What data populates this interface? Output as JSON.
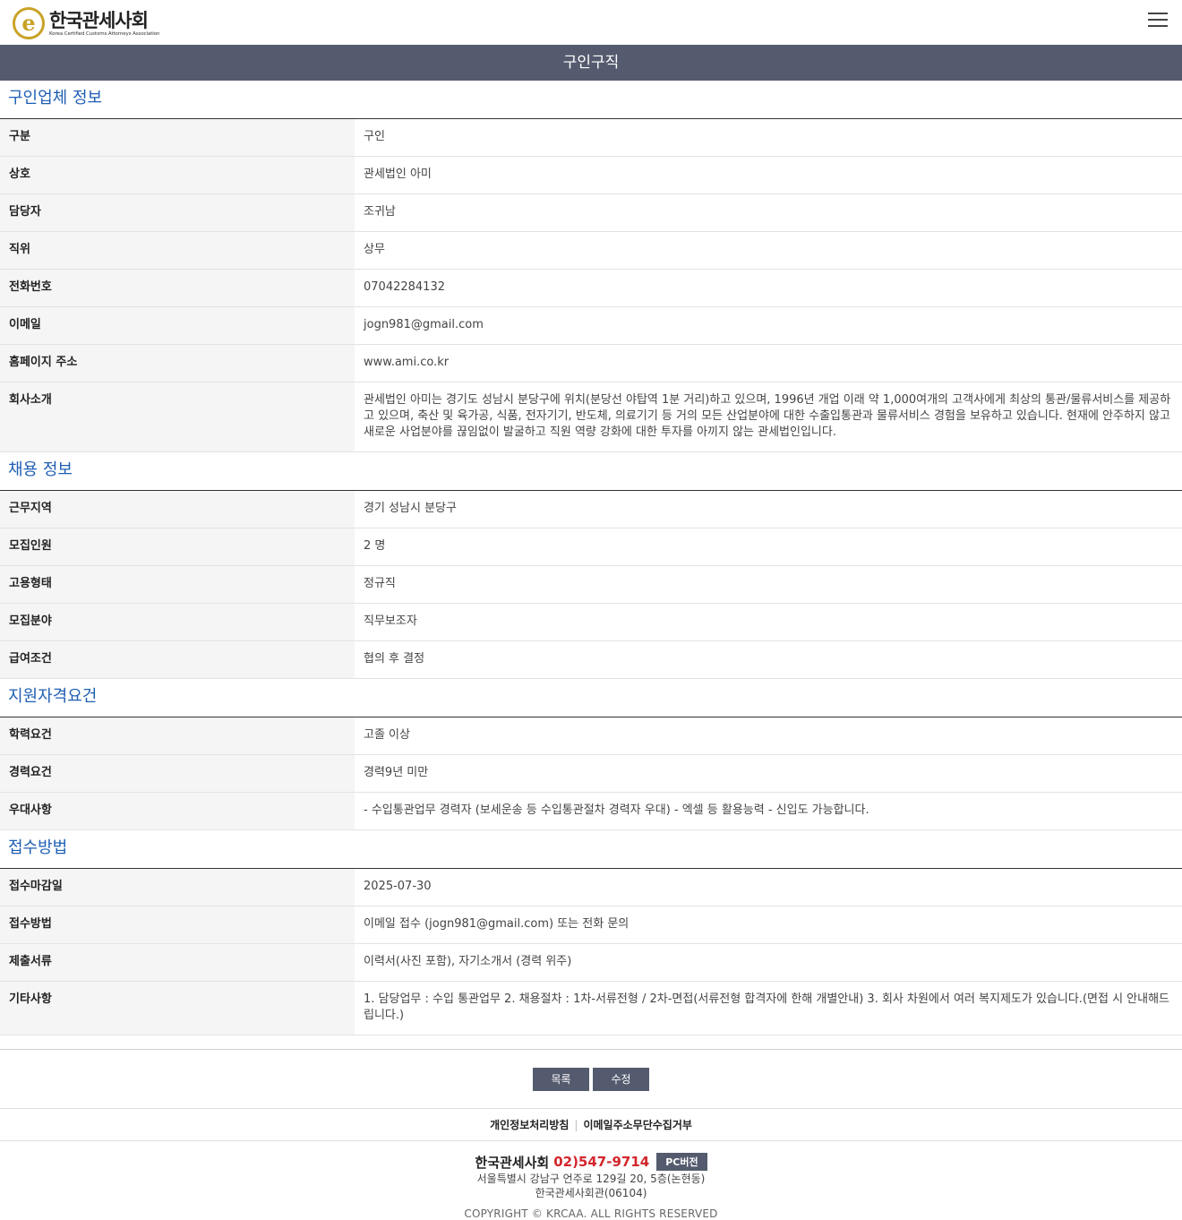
{
  "header": {
    "logo_mark": "e",
    "logo_title": "한국관세사회",
    "logo_sub": "Korea Certified Customs Attorneys Association"
  },
  "page_title": "구인구직",
  "sections": [
    {
      "title": "구인업체 정보",
      "rows": [
        {
          "label": "구분",
          "value": "구인"
        },
        {
          "label": "상호",
          "value": "관세법인 아미"
        },
        {
          "label": "담당자",
          "value": "조귀남"
        },
        {
          "label": "직위",
          "value": "상무"
        },
        {
          "label": "전화번호",
          "value": "07042284132"
        },
        {
          "label": "이메일",
          "value": "jogn981@gmail.com"
        },
        {
          "label": "홈페이지 주소",
          "value": "www.ami.co.kr"
        },
        {
          "label": "회사소개",
          "value": "관세법인 아미는 경기도 성남시 분당구에 위치(분당선 야탑역 1분 거리)하고 있으며, 1996년 개업 이래 약 1,000여개의 고객사에게 최상의 통관/물류서비스를 제공하고 있으며, 축산 및 육가공, 식품, 전자기기, 반도체, 의료기기 등 거의 모든 산업분야에 대한 수출입통관과 물류서비스 경험을 보유하고 있습니다. 현재에 안주하지 않고 새로운 사업분야를 끊임없이 발굴하고 직원 역량 강화에 대한 투자를 아끼지 않는 관세법인입니다."
        }
      ]
    },
    {
      "title": "채용 정보",
      "rows": [
        {
          "label": "근무지역",
          "value": "경기 성남시 분당구"
        },
        {
          "label": "모집인원",
          "value": "2 명"
        },
        {
          "label": "고용형태",
          "value": "정규직"
        },
        {
          "label": "모집분야",
          "value": "직무보조자"
        },
        {
          "label": "급여조건",
          "value": "협의 후 결정"
        }
      ]
    },
    {
      "title": "지원자격요건",
      "rows": [
        {
          "label": "학력요건",
          "value": "고졸 이상"
        },
        {
          "label": "경력요건",
          "value": "경력9년 미만"
        },
        {
          "label": "우대사항",
          "value": "- 수입통관업무 경력자 (보세운송 등 수입통관절차 경력자 우대) - 엑셀 등 활용능력 - 신입도 가능합니다."
        }
      ]
    },
    {
      "title": "접수방법",
      "rows": [
        {
          "label": "접수마감일",
          "value": "2025-07-30"
        },
        {
          "label": "접수방법",
          "value": "이메일 접수 (jogn981@gmail.com) 또는 전화 문의"
        },
        {
          "label": "제출서류",
          "value": "이력서(사진 포함), 자기소개서 (경력 위주)"
        },
        {
          "label": "기타사항",
          "value": "1. 담당업무 : 수입 통관업무 2. 채용절차 : 1차-서류전형 / 2차-면접(서류전형 합격자에 한해 개별안내) 3. 회사 차원에서 여러 복지제도가 있습니다.(면접 시 안내해드립니다.)"
        }
      ]
    }
  ],
  "buttons": {
    "list": "목록",
    "edit": "수정"
  },
  "policy": {
    "privacy": "개인정보처리방침",
    "email_refusal": "이메일주소무단수집거부"
  },
  "footer": {
    "org_name": "한국관세사회",
    "phone": "02)547-9714",
    "pc_version": "PC버전",
    "address_line1": "서울특별시 강남구 언주로 129길 20, 5층(논현동)",
    "address_line2": "한국관세사회관(06104)",
    "copyright": "COPYRIGHT © KRCAA. ALL RIGHTS RESERVED"
  },
  "colors": {
    "title_bar": "#545b6e",
    "section_title": "#1f5fb3",
    "phone": "#d2262c",
    "logo_gold": "#c9a227"
  }
}
